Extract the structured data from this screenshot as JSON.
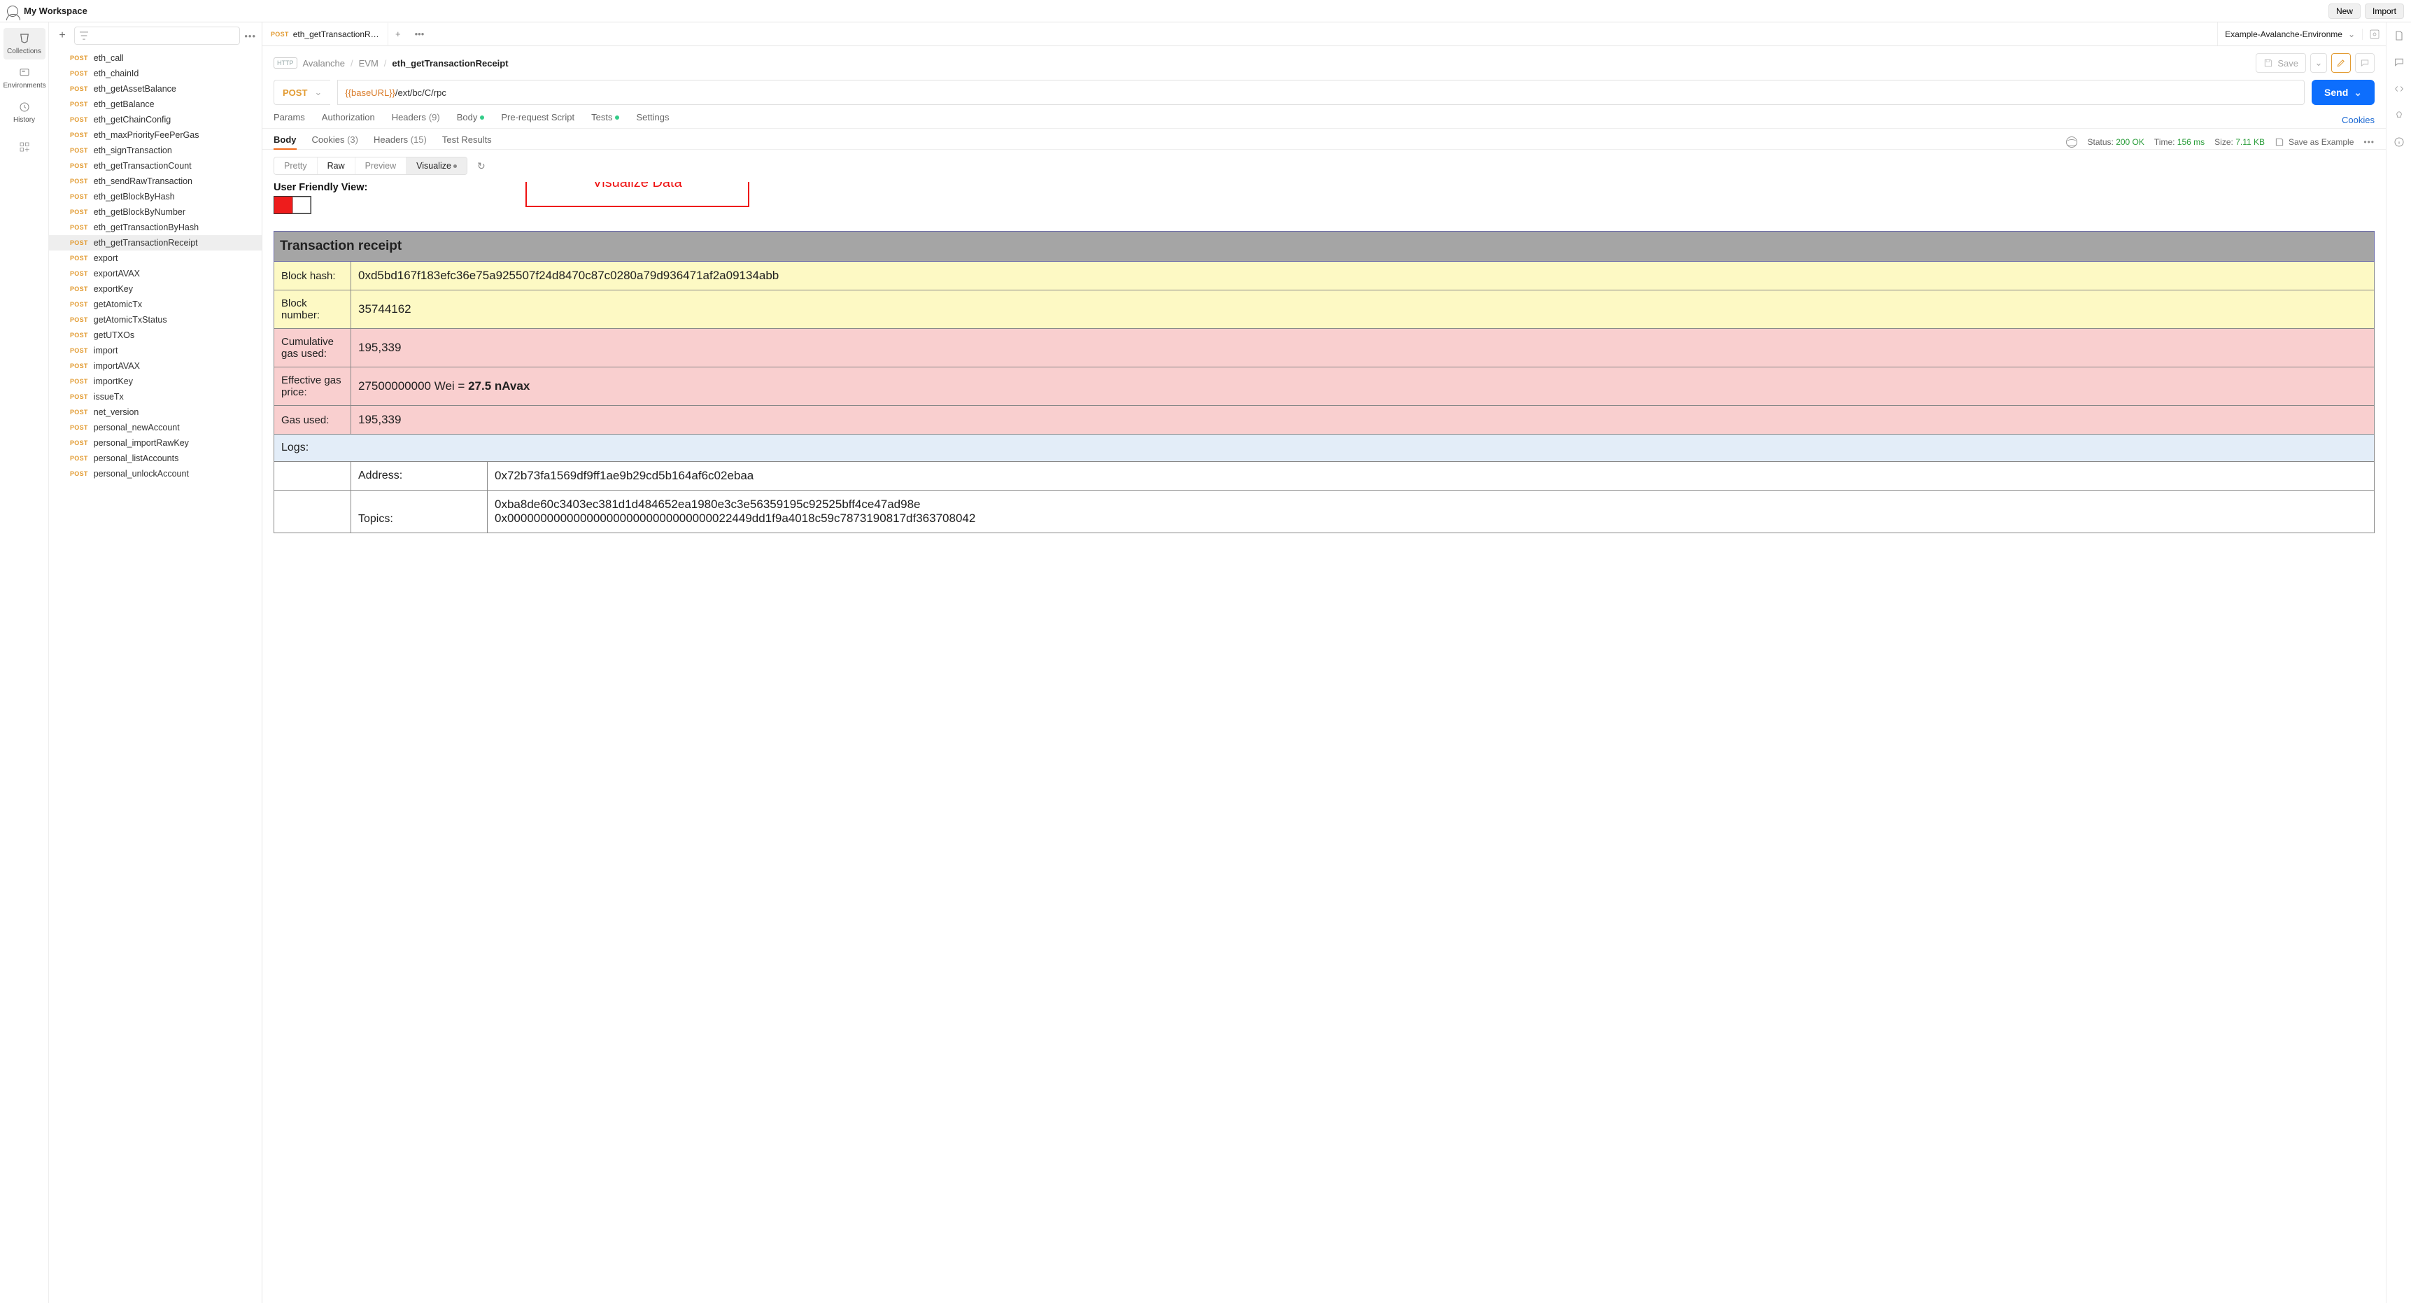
{
  "workspace": {
    "title": "My Workspace",
    "new_btn": "New",
    "import_btn": "Import"
  },
  "leftrail": [
    {
      "label": "Collections",
      "active": true
    },
    {
      "label": "Environments",
      "active": false
    },
    {
      "label": "History",
      "active": false
    }
  ],
  "sidebar": {
    "items": [
      {
        "method": "POST",
        "name": "eth_call"
      },
      {
        "method": "POST",
        "name": "eth_chainId"
      },
      {
        "method": "POST",
        "name": "eth_getAssetBalance"
      },
      {
        "method": "POST",
        "name": "eth_getBalance"
      },
      {
        "method": "POST",
        "name": "eth_getChainConfig"
      },
      {
        "method": "POST",
        "name": "eth_maxPriorityFeePerGas"
      },
      {
        "method": "POST",
        "name": "eth_signTransaction"
      },
      {
        "method": "POST",
        "name": "eth_getTransactionCount"
      },
      {
        "method": "POST",
        "name": "eth_sendRawTransaction"
      },
      {
        "method": "POST",
        "name": "eth_getBlockByHash"
      },
      {
        "method": "POST",
        "name": "eth_getBlockByNumber"
      },
      {
        "method": "POST",
        "name": "eth_getTransactionByHash"
      },
      {
        "method": "POST",
        "name": "eth_getTransactionReceipt",
        "active": true
      },
      {
        "method": "POST",
        "name": "export"
      },
      {
        "method": "POST",
        "name": "exportAVAX"
      },
      {
        "method": "POST",
        "name": "exportKey"
      },
      {
        "method": "POST",
        "name": "getAtomicTx"
      },
      {
        "method": "POST",
        "name": "getAtomicTxStatus"
      },
      {
        "method": "POST",
        "name": "getUTXOs"
      },
      {
        "method": "POST",
        "name": "import"
      },
      {
        "method": "POST",
        "name": "importAVAX"
      },
      {
        "method": "POST",
        "name": "importKey"
      },
      {
        "method": "POST",
        "name": "issueTx"
      },
      {
        "method": "POST",
        "name": "net_version"
      },
      {
        "method": "POST",
        "name": "personal_newAccount"
      },
      {
        "method": "POST",
        "name": "personal_importRawKey"
      },
      {
        "method": "POST",
        "name": "personal_listAccounts"
      },
      {
        "method": "POST",
        "name": "personal_unlockAccount"
      }
    ]
  },
  "tabs": {
    "open": [
      {
        "method": "POST",
        "name": "eth_getTransactionRece"
      }
    ]
  },
  "env": {
    "name": "Example-Avalanche-Environme"
  },
  "breadcrumbs": {
    "http_icon": "HTTP",
    "path": [
      "Avalanche",
      "EVM",
      "eth_getTransactionReceipt"
    ],
    "save_label": "Save"
  },
  "request": {
    "method": "POST",
    "url_var": "{{baseURL}}",
    "url_rest": "/ext/bc/C/rpc",
    "send_label": "Send"
  },
  "reqtabs": {
    "params": "Params",
    "auth": "Authorization",
    "headers": "Headers",
    "headers_count": "(9)",
    "body": "Body",
    "prereq": "Pre-request Script",
    "tests": "Tests",
    "settings": "Settings",
    "cookies": "Cookies"
  },
  "resptabs": {
    "body": "Body",
    "cookies": "Cookies",
    "cookies_count": "(3)",
    "headers": "Headers",
    "headers_count": "(15)",
    "tests": "Test Results"
  },
  "resp_meta": {
    "status_label": "Status:",
    "status": "200 OK",
    "time_label": "Time:",
    "time": "156 ms",
    "size_label": "Size:",
    "size": "7.11 KB",
    "save_example": "Save as Example"
  },
  "viewbar": {
    "pretty": "Pretty",
    "raw": "Raw",
    "preview": "Preview",
    "visualize": "Visualize"
  },
  "visual": {
    "ufv_label": "User Friendly View:",
    "callout": "Visualize Data"
  },
  "receipt": {
    "title": "Transaction receipt",
    "rows": {
      "block_hash_label": "Block hash:",
      "block_hash": "0xd5bd167f183efc36e75a925507f24d8470c87c0280a79d936471af2a09134abb",
      "block_number_label": "Block number:",
      "block_number": "35744162",
      "cum_gas_label": "Cumulative gas used:",
      "cum_gas": "195,339",
      "eff_gas_label": "Effective gas price:",
      "eff_gas_prefix": "27500000000 Wei = ",
      "eff_gas_bold": "27.5 nAvax",
      "gas_used_label": "Gas used:",
      "gas_used": "195,339",
      "logs_label": "Logs:",
      "address_label": "Address:",
      "address": "0x72b73fa1569df9ff1ae9b29cd5b164af6c02ebaa",
      "topics_label": "Topics:",
      "topics_line1": "0xba8de60c3403ec381d1d484652ea1980e3c3e56359195c92525bff4ce47ad98e",
      "topics_line2": "0x0000000000000000000000000000000022449dd1f9a4018c59c7873190817df363708042"
    }
  }
}
